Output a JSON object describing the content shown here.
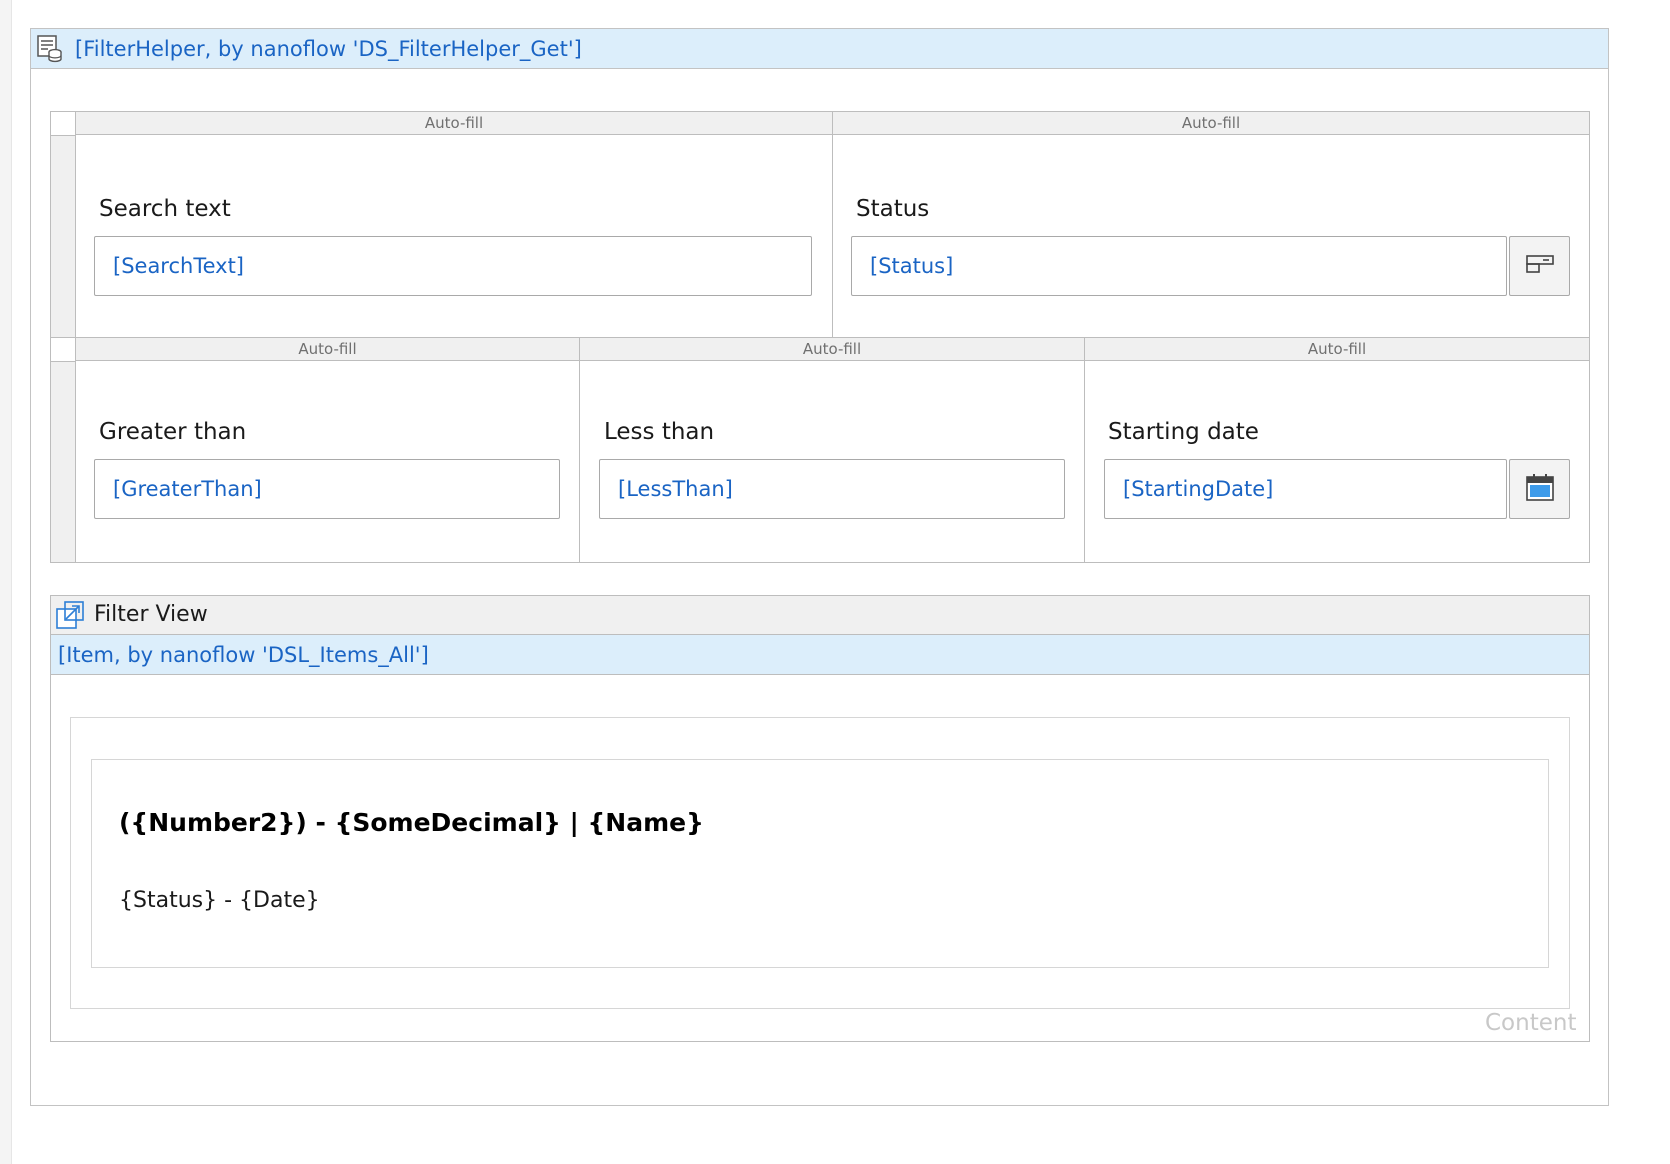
{
  "dataview": {
    "header_text": "[FilterHelper, by nanoflow 'DS_FilterHelper_Get']",
    "icon": "dataview-database-icon"
  },
  "layout_grid": {
    "autofill_label": "Auto-fill",
    "row1": {
      "search": {
        "label": "Search text",
        "value": "[SearchText]"
      },
      "status": {
        "label": "Status",
        "value": "[Status]",
        "button_icon": "dropdown-select-icon"
      }
    },
    "row2": {
      "greater": {
        "label": "Greater than",
        "value": "[GreaterThan]"
      },
      "less": {
        "label": "Less than",
        "value": "[LessThan]"
      },
      "date": {
        "label": "Starting date",
        "value": "[StartingDate]",
        "button_icon": "calendar-icon"
      }
    }
  },
  "filter_view": {
    "title": "Filter View",
    "icon": "snippet-open-icon",
    "list_header": "[Item, by nanoflow 'DSL_Items_All']",
    "item": {
      "title": "({Number2}) - {SomeDecimal} | {Name}",
      "subtitle": "{Status} - {Date}"
    },
    "content_label": "Content"
  },
  "colors": {
    "accent_blue": "#1a64c4",
    "header_bg": "#dceefb",
    "border": "#bdbdbd"
  }
}
